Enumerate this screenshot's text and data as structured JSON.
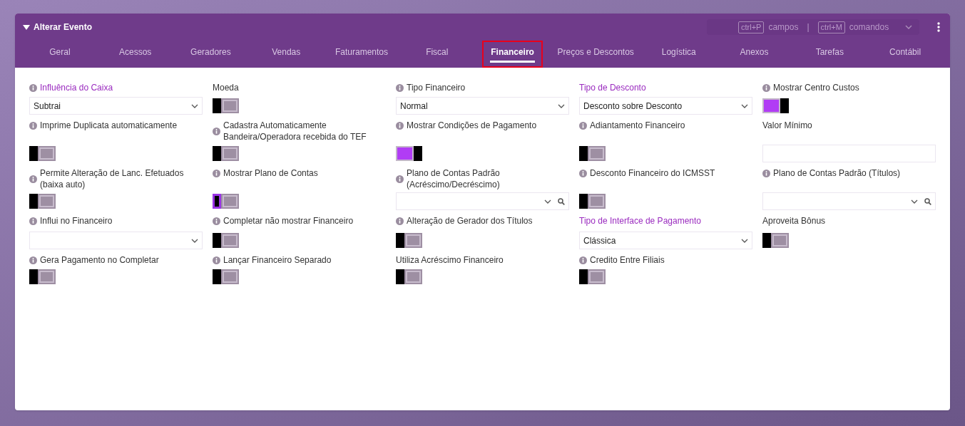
{
  "window": {
    "title": "Alterar Evento"
  },
  "shortcuts": [
    {
      "key": "ctrl+P",
      "label": "campos"
    },
    {
      "key": "ctrl+M",
      "label": "comandos"
    }
  ],
  "separator": "|",
  "tabs": [
    {
      "label": "Geral",
      "selected": false
    },
    {
      "label": "Acessos",
      "selected": false
    },
    {
      "label": "Geradores",
      "selected": false
    },
    {
      "label": "Vendas",
      "selected": false
    },
    {
      "label": "Faturamentos",
      "selected": false
    },
    {
      "label": "Fiscal",
      "selected": false
    },
    {
      "label": "Financeiro",
      "selected": true,
      "highlighted": true
    },
    {
      "label": "Preços e Descontos",
      "selected": false
    },
    {
      "label": "Logística",
      "selected": false
    },
    {
      "label": "Anexos",
      "selected": false
    },
    {
      "label": "Tarefas",
      "selected": false
    },
    {
      "label": "Contábil",
      "selected": false
    }
  ],
  "rows": [
    [
      {
        "label": "Influência do Caixa",
        "info": true,
        "required": true,
        "kind": "select",
        "value": "Subtrai"
      },
      {
        "label": "Moeda",
        "info": false,
        "required": false,
        "kind": "toggle",
        "on": false,
        "focused": false
      },
      {
        "label": "Tipo Financeiro",
        "info": true,
        "required": false,
        "kind": "select",
        "value": "Normal"
      },
      {
        "label": "Tipo de Desconto",
        "info": false,
        "required": true,
        "kind": "select",
        "value": "Desconto sobre Desconto"
      },
      {
        "label": "Mostrar Centro Custos",
        "info": true,
        "required": false,
        "kind": "toggle",
        "on": true,
        "focused": false
      }
    ],
    [
      {
        "label": "Imprime Duplicata automaticamente",
        "info": true,
        "required": false,
        "kind": "toggle",
        "on": false,
        "focused": false
      },
      {
        "label": "Cadastra Automaticamente Bandeira/Operadora recebida do TEF",
        "info": true,
        "required": false,
        "kind": "toggle",
        "on": false,
        "focused": false
      },
      {
        "label": "Mostrar Condições de Pagamento",
        "info": true,
        "required": false,
        "kind": "toggle",
        "on": true,
        "focused": false
      },
      {
        "label": "Adiantamento Financeiro",
        "info": true,
        "required": false,
        "kind": "toggle",
        "on": false,
        "focused": false
      },
      {
        "label": "Valor Mínimo",
        "info": false,
        "required": false,
        "kind": "text"
      }
    ],
    [
      {
        "label": "Permite Alteração de Lanc. Efetuados (baixa auto)",
        "info": true,
        "required": false,
        "kind": "toggle",
        "on": false,
        "focused": false
      },
      {
        "label": "Mostrar Plano de Contas",
        "info": true,
        "required": false,
        "kind": "toggle",
        "on": false,
        "focused": true
      },
      {
        "label": "Plano de Contas Padrão (Acréscimo/Decréscimo)",
        "info": true,
        "required": false,
        "kind": "lookup"
      },
      {
        "label": "Desconto Financeiro do ICMSST",
        "info": true,
        "required": false,
        "kind": "toggle",
        "on": false,
        "focused": false
      },
      {
        "label": "Plano de Contas Padrão (Títulos)",
        "info": true,
        "required": false,
        "kind": "lookup"
      }
    ],
    [
      {
        "label": "Influi no Financeiro",
        "info": true,
        "required": false,
        "kind": "select"
      },
      {
        "label": "Completar não mostrar Financeiro",
        "info": true,
        "required": false,
        "kind": "toggle",
        "on": false,
        "focused": false
      },
      {
        "label": "Alteração de Gerador dos Títulos",
        "info": true,
        "required": false,
        "kind": "toggle",
        "on": false,
        "focused": false
      },
      {
        "label": "Tipo de Interface de Pagamento",
        "info": false,
        "required": true,
        "kind": "select",
        "value": "Clássica"
      },
      {
        "label": "Aproveita Bônus",
        "info": false,
        "required": false,
        "kind": "toggle",
        "on": false,
        "focused": false
      }
    ],
    [
      {
        "label": "Gera Pagamento no Completar",
        "info": true,
        "required": false,
        "kind": "toggle",
        "on": false,
        "focused": false
      },
      {
        "label": "Lançar Financeiro Separado",
        "info": true,
        "required": false,
        "kind": "toggle",
        "on": false,
        "focused": false
      },
      {
        "label": "Utiliza Acréscimo Financeiro",
        "info": false,
        "required": false,
        "kind": "toggle",
        "on": false,
        "focused": false
      },
      {
        "label": "Credito Entre Filiais",
        "info": true,
        "required": false,
        "kind": "toggle",
        "on": false,
        "focused": false
      }
    ]
  ]
}
